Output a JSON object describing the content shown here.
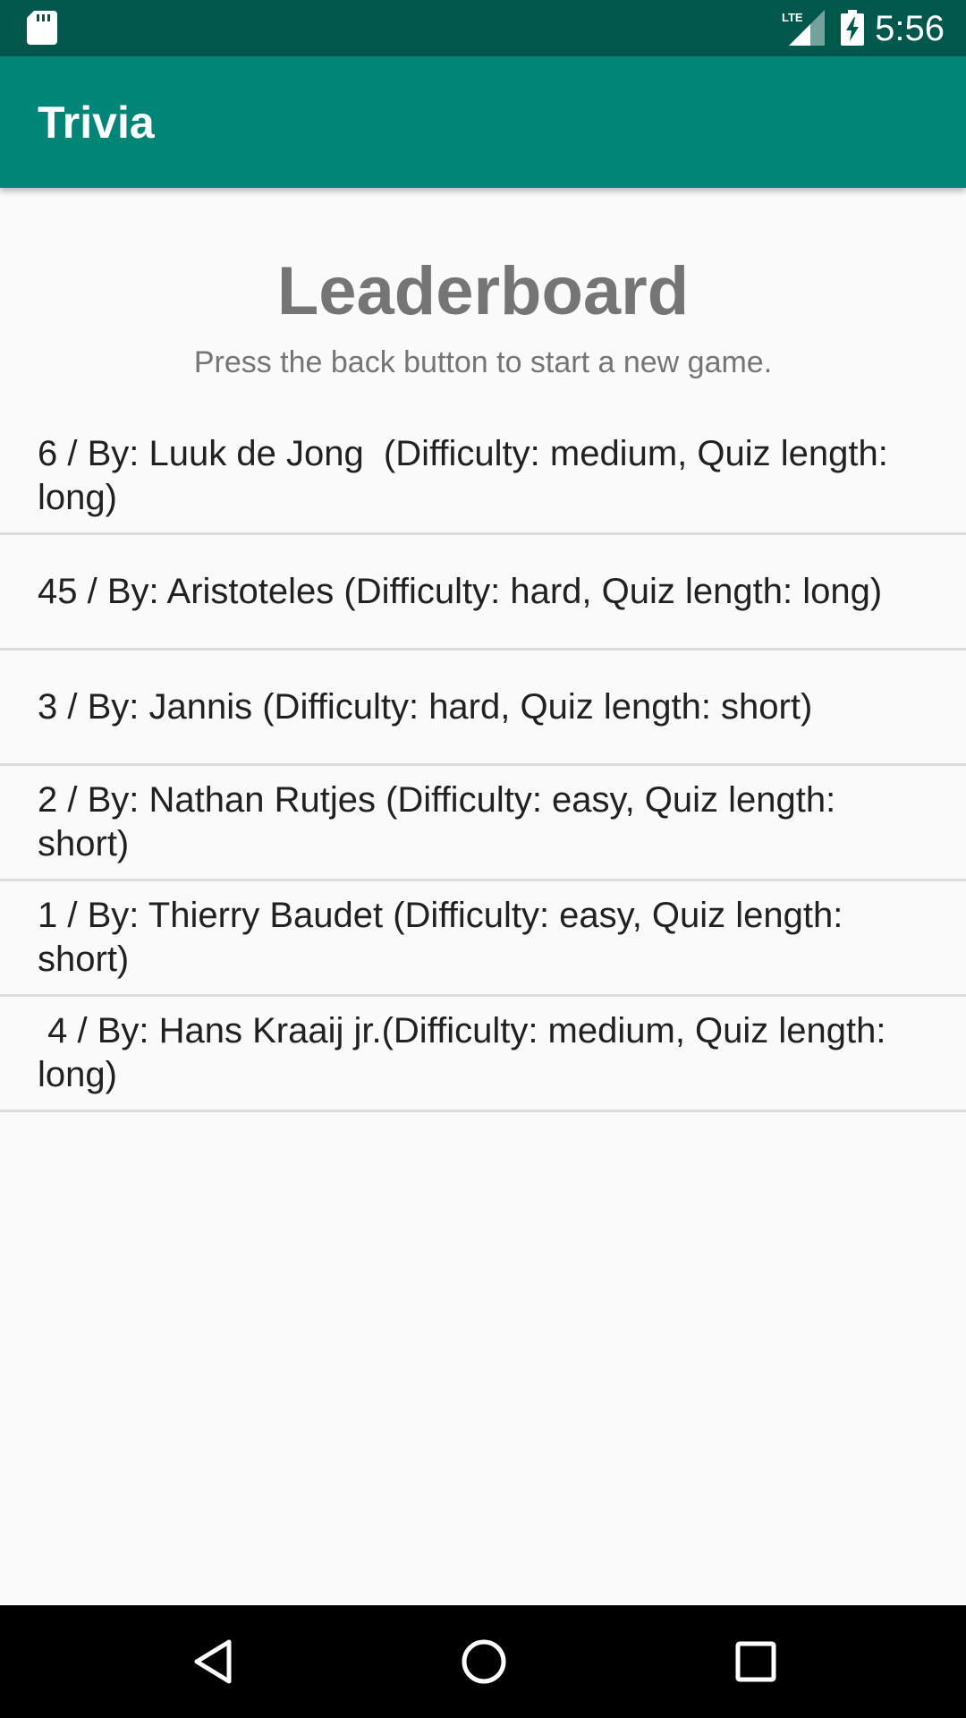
{
  "status_bar": {
    "time": "5:56",
    "network": "LTE",
    "icons": [
      "sd-card-icon",
      "lte-signal-icon",
      "battery-charging-icon"
    ]
  },
  "app_bar": {
    "title": "Trivia"
  },
  "main": {
    "title": "Leaderboard",
    "subtitle": "Press the back button to start a new game.",
    "entries": [
      "6 / By: Luuk de Jong  (Difficulty: medium, Quiz length: long)",
      "45 / By: Aristoteles (Difficulty: hard, Quiz length: long)",
      "3 / By: Jannis (Difficulty: hard, Quiz length: short)",
      "2 / By: Nathan Rutjes (Difficulty: easy, Quiz length: short)",
      "1 / By: Thierry Baudet (Difficulty: easy, Quiz length: short)",
      " 4 / By: Hans Kraaij jr.(Difficulty: medium, Quiz length: long)"
    ]
  },
  "nav_bar": {
    "icons": [
      "back-icon",
      "home-icon",
      "recents-icon"
    ]
  },
  "colors": {
    "status_bar": "#00574b",
    "app_bar": "#008577",
    "title_text": "#757575",
    "background": "#fafafa",
    "divider": "#dcdcdc"
  }
}
